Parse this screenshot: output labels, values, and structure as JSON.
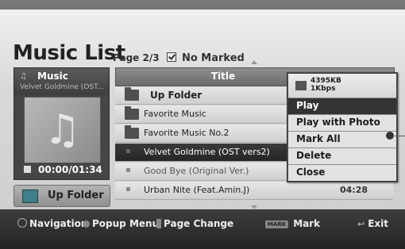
{
  "app": {
    "title": "Music List",
    "page_info": "Page 2/3",
    "filter_label": "No Marked"
  },
  "now_playing": {
    "header": "Music",
    "subtitle": "Velvet Goldmine (OST...",
    "time": "00:00/01:34",
    "up_folder_label": "Up Folder",
    "icons": {
      "music": "music-icon",
      "art": "music-note-icon",
      "stop": "stop-icon",
      "folder": "folder-icon"
    }
  },
  "list": {
    "column_title": "Title",
    "rows": [
      {
        "type": "up",
        "label": "Up Folder"
      },
      {
        "type": "folder",
        "label": "Favorite Music"
      },
      {
        "type": "folder",
        "label": "Favorite Music No.2"
      },
      {
        "type": "file",
        "label": "Velvet Goldmine (OST vers2)",
        "selected": true
      },
      {
        "type": "file",
        "label": "Good Bye (Original Ver.)",
        "dim": true
      },
      {
        "type": "file",
        "label": "Urban Nite (Feat.Amin.J)",
        "duration": "04:28"
      }
    ]
  },
  "popup": {
    "size": "4395KB",
    "bitrate": "1Kbps",
    "items": [
      "Play",
      "Play with Photo",
      "Mark All",
      "Delete",
      "Close"
    ],
    "highlighted": "Play"
  },
  "bottom_bar": {
    "navigation": "Navigation",
    "popup_menu": "Popup Menu",
    "page_change": "Page Change",
    "mark_key": "MARK",
    "mark": "Mark",
    "exit": "Exit"
  }
}
